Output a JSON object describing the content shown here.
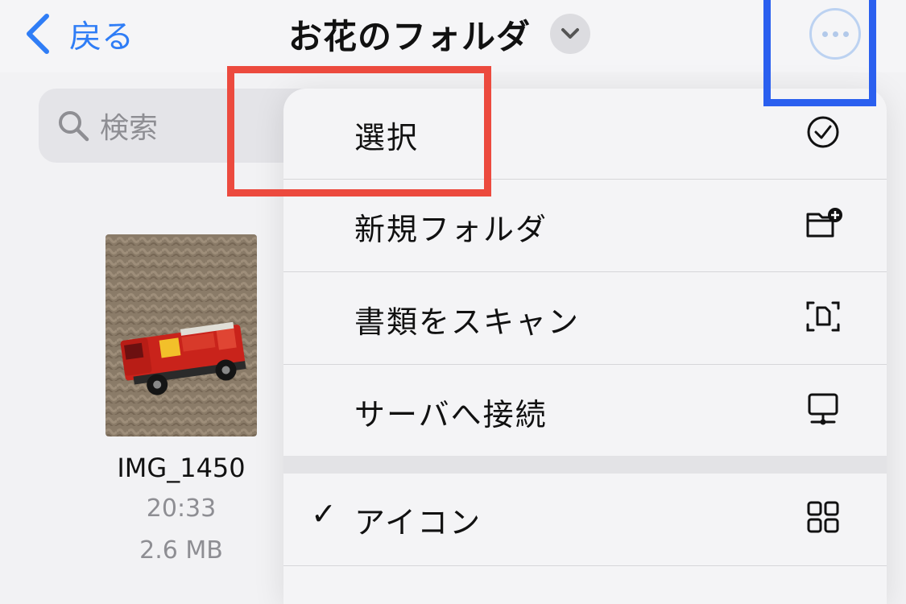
{
  "nav": {
    "back_label": "戻る",
    "title": "お花のフォルダ"
  },
  "search": {
    "placeholder": "検索"
  },
  "file": {
    "name": "IMG_1450",
    "time": "20:33",
    "size": "2.6 MB"
  },
  "menu": {
    "items": [
      {
        "label": "選択",
        "icon": "checkmark-circle-icon"
      },
      {
        "label": "新規フォルダ",
        "icon": "folder-badge-plus-icon"
      },
      {
        "label": "書類をスキャン",
        "icon": "doc-viewfinder-icon"
      },
      {
        "label": "サーバへ接続",
        "icon": "server-display-icon"
      }
    ],
    "view_options": [
      {
        "label": "アイコン",
        "checked": true,
        "icon": "grid-icon"
      }
    ]
  },
  "colors": {
    "accent": "#2f7df6",
    "highlight_red": "#ec4a3e",
    "highlight_blue": "#2a5fef"
  }
}
